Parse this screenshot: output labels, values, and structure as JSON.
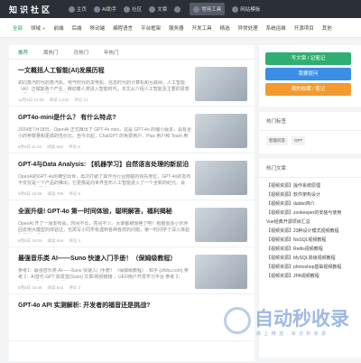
{
  "site": {
    "logo": "知识社区"
  },
  "topnav": [
    {
      "label": "主页",
      "icon": "home-icon"
    },
    {
      "label": "AI助手",
      "icon": "ai-icon"
    },
    {
      "label": "社区",
      "icon": "community-icon"
    },
    {
      "label": "文章",
      "icon": "article-icon"
    },
    {
      "label": "",
      "icon": "media-icon"
    },
    {
      "label": "常用工具",
      "icon": "tools-icon"
    },
    {
      "label": "网站模板",
      "icon": "template-icon"
    }
  ],
  "categories": [
    "全部",
    "领域",
    "前端",
    "后端",
    "移动端",
    "编程语言",
    "平台框架",
    "服务器",
    "开发工具",
    "精选",
    "异常处理",
    "系统运维",
    "开源项目",
    "其他"
  ],
  "tabs": [
    "推荐",
    "周热门",
    "月热门",
    "年热门"
  ],
  "articles": [
    {
      "title": "一文概括人工智能(AI)发展历程",
      "summary": "如同蒸汽时代的蒸汽机、电气时代的发电机、信息时代的计算机和互联网，人工智能（AI）正赋能各个产业，推动着人类进入智能时代。本文从介绍人工智能及主要的思想派系，进一步系统地梳理了",
      "date": "11月3日 12:08",
      "views": "阅读 1,234",
      "likes": "评论 21"
    },
    {
      "title": "GPT4o-mini是什么？ 有什么特点?",
      "summary": "2024年7月18日，OpenAI 正式推出了 GPT-4o mini，这是 GPT-4o 的缩小版本，具有更小的参数量和更高的性价比。自今日起，ChatGPT 的免费用户、Plus 用户和 Team 用户将能够使用 GPT-4o mini",
      "date": "8月6日 11:04",
      "views": "阅读 982",
      "likes": "评论 8"
    },
    {
      "title": "GPT-4与Data Analysis: 【机器学习】自然语言处理的新前沿",
      "summary": "OpenAI的GPT-4o的横空出世，再次打破了其作为行业翘楚的领先地位，GPT-4o的发布不仅仅是一个产品的推出，它更像是向世界宣布人工智能进入了一个全新的纪元，会OpenAI的领航者身份",
      "date": "8月5日 16:08",
      "views": "阅读 765",
      "likes": "评论 5"
    },
    {
      "title": "全面升级! GPT-4o 第一时间体验，聪明解答，福利揭秘",
      "summary": "OpenAI 开了一场发布会，时间不长，亮点不少。大家都被惊艳了吧！根据很多小伙伴回去用大模型的体验过，也再写小同学有遇到各种各样的问题，第一时间学了深入体验和测试，现在分享出来",
      "date": "8月5日 16:04",
      "views": "阅读 654",
      "likes": "评论 4"
    },
    {
      "title": "最强音乐类 AI——Suno 快速入门手册！（保姆级教程）",
      "summary": "参考1：最强音乐类 AI——Suno 快速入门手册！（保姆级教程）- 知乎 (zhihu.com) 参考 2：AI音乐 GPT 如发音(Suno) 文章/视频链接 ，UEO用户开发学习平台 参考 3：Suno V3发布，AI的玩法",
      "date": "8月5日 15:48",
      "views": "阅读 543",
      "likes": "评论 3"
    },
    {
      "title": "GPT-4o API 实测解析: 开发者的福音还是挑战?",
      "summary": "",
      "date": "",
      "views": "",
      "likes": ""
    }
  ],
  "sidebar": {
    "buttons": [
      "写文章 / 记笔记",
      "我要提问",
      "我的收藏 / 笔记"
    ],
    "tags_title": "热门标签",
    "tags": [
      "智能问答",
      "GPT"
    ],
    "hot_title": "热门文章",
    "hot_items": [
      "【视频资源】操作系统原理",
      "【视频资源】软件架构设计",
      "【视频资源】dubbo简介",
      "【视频资源】zookeeper的安装与使用",
      "Vue经典开源项目汇总",
      "【视频资源】23种设计模式视频教程",
      "【视频资源】NoSQL视频教程",
      "【视频资源】Redis视频教程",
      "【视频资源】MySQL高级视频教程",
      "【视频资源】photoshop基础视频教程",
      "【视频资源】JPA视频教程"
    ]
  },
  "watermark": {
    "text": "自动秒收录",
    "sub": "做 上 精 选 · 来 访 秒 收 录"
  },
  "colors": {
    "accent": "#1e9b64",
    "topbar": "#2b2f36",
    "btn_green": "#2fae73",
    "btn_blue": "#3a8ee6",
    "btn_orange": "#f29a2e"
  }
}
